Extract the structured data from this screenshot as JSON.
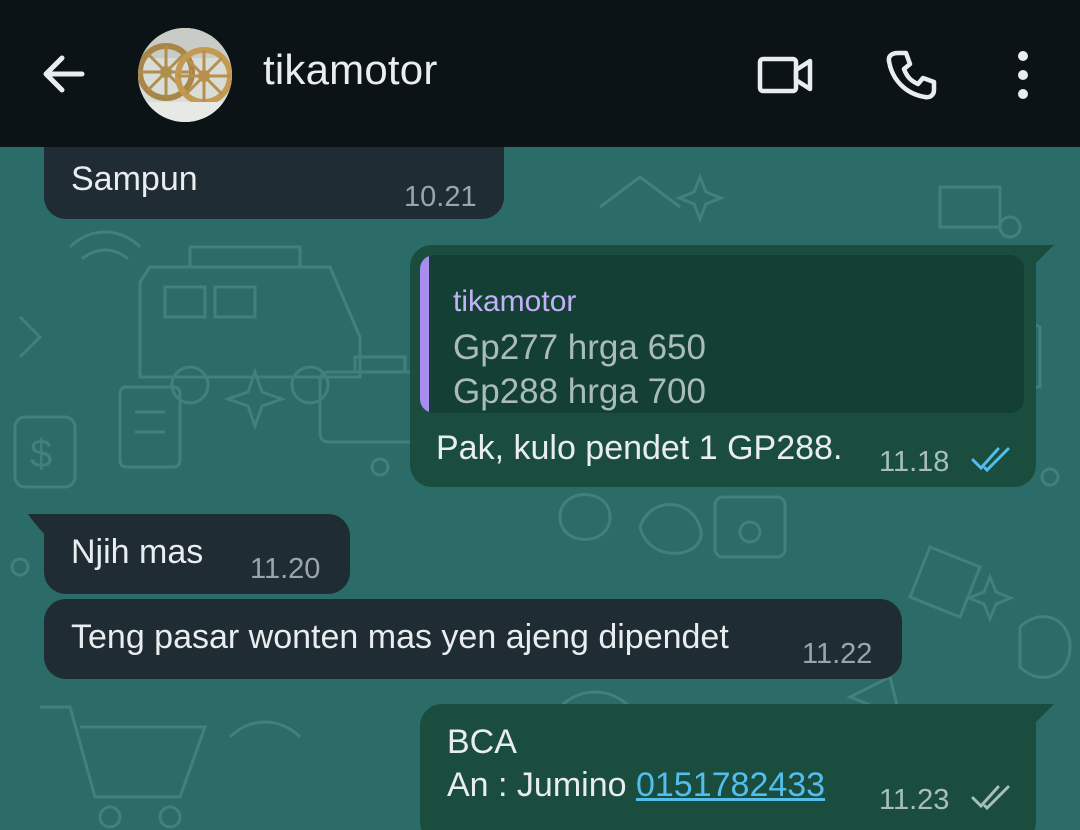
{
  "header": {
    "contact_name": "tikamotor"
  },
  "messages": [
    {
      "direction": "in",
      "text": "Sampun",
      "time": "10.21"
    },
    {
      "direction": "out",
      "quote": {
        "author": "tikamotor",
        "lines": [
          "Gp277 hrga 650",
          "Gp288 hrga 700"
        ]
      },
      "text": "Pak, kulo pendet 1 GP288.",
      "time": "11.18",
      "status": "read"
    },
    {
      "direction": "in",
      "text": "Njih mas",
      "time": "11.20"
    },
    {
      "direction": "in",
      "text": "Teng pasar wonten mas yen ajeng dipendet",
      "time": "11.22"
    },
    {
      "direction": "out",
      "line1": "BCA",
      "line2_prefix": "An : Jumino ",
      "line2_link": "0151782433",
      "time": "11.23",
      "status": "delivered"
    }
  ],
  "colors": {
    "header_bg": "#0c1317",
    "chat_bg": "#2b6b68",
    "incoming_bubble": "#1f2c33",
    "outgoing_bubble": "#1a4d3e",
    "read_ticks": "#53bdeb",
    "link": "#53bdeb",
    "quote_bar": "#a88cf0"
  },
  "icons": [
    "back-arrow-icon",
    "video-call-icon",
    "phone-icon",
    "more-options-icon",
    "read-ticks-icon",
    "delivered-ticks-icon"
  ]
}
